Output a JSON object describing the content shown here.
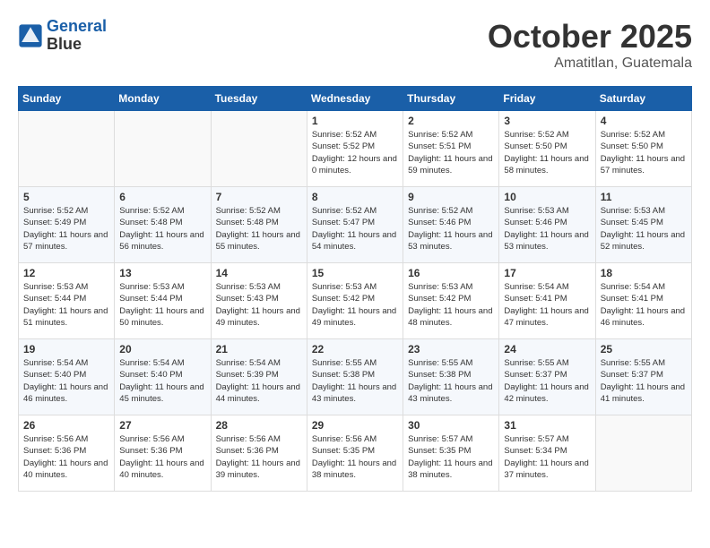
{
  "header": {
    "logo_line1": "General",
    "logo_line2": "Blue",
    "month": "October 2025",
    "location": "Amatitlan, Guatemala"
  },
  "days_of_week": [
    "Sunday",
    "Monday",
    "Tuesday",
    "Wednesday",
    "Thursday",
    "Friday",
    "Saturday"
  ],
  "weeks": [
    [
      {
        "num": "",
        "sunrise": "",
        "sunset": "",
        "daylight": "",
        "empty": true
      },
      {
        "num": "",
        "sunrise": "",
        "sunset": "",
        "daylight": "",
        "empty": true
      },
      {
        "num": "",
        "sunrise": "",
        "sunset": "",
        "daylight": "",
        "empty": true
      },
      {
        "num": "1",
        "sunrise": "Sunrise: 5:52 AM",
        "sunset": "Sunset: 5:52 PM",
        "daylight": "Daylight: 12 hours and 0 minutes.",
        "empty": false
      },
      {
        "num": "2",
        "sunrise": "Sunrise: 5:52 AM",
        "sunset": "Sunset: 5:51 PM",
        "daylight": "Daylight: 11 hours and 59 minutes.",
        "empty": false
      },
      {
        "num": "3",
        "sunrise": "Sunrise: 5:52 AM",
        "sunset": "Sunset: 5:50 PM",
        "daylight": "Daylight: 11 hours and 58 minutes.",
        "empty": false
      },
      {
        "num": "4",
        "sunrise": "Sunrise: 5:52 AM",
        "sunset": "Sunset: 5:50 PM",
        "daylight": "Daylight: 11 hours and 57 minutes.",
        "empty": false
      }
    ],
    [
      {
        "num": "5",
        "sunrise": "Sunrise: 5:52 AM",
        "sunset": "Sunset: 5:49 PM",
        "daylight": "Daylight: 11 hours and 57 minutes.",
        "empty": false
      },
      {
        "num": "6",
        "sunrise": "Sunrise: 5:52 AM",
        "sunset": "Sunset: 5:48 PM",
        "daylight": "Daylight: 11 hours and 56 minutes.",
        "empty": false
      },
      {
        "num": "7",
        "sunrise": "Sunrise: 5:52 AM",
        "sunset": "Sunset: 5:48 PM",
        "daylight": "Daylight: 11 hours and 55 minutes.",
        "empty": false
      },
      {
        "num": "8",
        "sunrise": "Sunrise: 5:52 AM",
        "sunset": "Sunset: 5:47 PM",
        "daylight": "Daylight: 11 hours and 54 minutes.",
        "empty": false
      },
      {
        "num": "9",
        "sunrise": "Sunrise: 5:52 AM",
        "sunset": "Sunset: 5:46 PM",
        "daylight": "Daylight: 11 hours and 53 minutes.",
        "empty": false
      },
      {
        "num": "10",
        "sunrise": "Sunrise: 5:53 AM",
        "sunset": "Sunset: 5:46 PM",
        "daylight": "Daylight: 11 hours and 53 minutes.",
        "empty": false
      },
      {
        "num": "11",
        "sunrise": "Sunrise: 5:53 AM",
        "sunset": "Sunset: 5:45 PM",
        "daylight": "Daylight: 11 hours and 52 minutes.",
        "empty": false
      }
    ],
    [
      {
        "num": "12",
        "sunrise": "Sunrise: 5:53 AM",
        "sunset": "Sunset: 5:44 PM",
        "daylight": "Daylight: 11 hours and 51 minutes.",
        "empty": false
      },
      {
        "num": "13",
        "sunrise": "Sunrise: 5:53 AM",
        "sunset": "Sunset: 5:44 PM",
        "daylight": "Daylight: 11 hours and 50 minutes.",
        "empty": false
      },
      {
        "num": "14",
        "sunrise": "Sunrise: 5:53 AM",
        "sunset": "Sunset: 5:43 PM",
        "daylight": "Daylight: 11 hours and 49 minutes.",
        "empty": false
      },
      {
        "num": "15",
        "sunrise": "Sunrise: 5:53 AM",
        "sunset": "Sunset: 5:42 PM",
        "daylight": "Daylight: 11 hours and 49 minutes.",
        "empty": false
      },
      {
        "num": "16",
        "sunrise": "Sunrise: 5:53 AM",
        "sunset": "Sunset: 5:42 PM",
        "daylight": "Daylight: 11 hours and 48 minutes.",
        "empty": false
      },
      {
        "num": "17",
        "sunrise": "Sunrise: 5:54 AM",
        "sunset": "Sunset: 5:41 PM",
        "daylight": "Daylight: 11 hours and 47 minutes.",
        "empty": false
      },
      {
        "num": "18",
        "sunrise": "Sunrise: 5:54 AM",
        "sunset": "Sunset: 5:41 PM",
        "daylight": "Daylight: 11 hours and 46 minutes.",
        "empty": false
      }
    ],
    [
      {
        "num": "19",
        "sunrise": "Sunrise: 5:54 AM",
        "sunset": "Sunset: 5:40 PM",
        "daylight": "Daylight: 11 hours and 46 minutes.",
        "empty": false
      },
      {
        "num": "20",
        "sunrise": "Sunrise: 5:54 AM",
        "sunset": "Sunset: 5:40 PM",
        "daylight": "Daylight: 11 hours and 45 minutes.",
        "empty": false
      },
      {
        "num": "21",
        "sunrise": "Sunrise: 5:54 AM",
        "sunset": "Sunset: 5:39 PM",
        "daylight": "Daylight: 11 hours and 44 minutes.",
        "empty": false
      },
      {
        "num": "22",
        "sunrise": "Sunrise: 5:55 AM",
        "sunset": "Sunset: 5:38 PM",
        "daylight": "Daylight: 11 hours and 43 minutes.",
        "empty": false
      },
      {
        "num": "23",
        "sunrise": "Sunrise: 5:55 AM",
        "sunset": "Sunset: 5:38 PM",
        "daylight": "Daylight: 11 hours and 43 minutes.",
        "empty": false
      },
      {
        "num": "24",
        "sunrise": "Sunrise: 5:55 AM",
        "sunset": "Sunset: 5:37 PM",
        "daylight": "Daylight: 11 hours and 42 minutes.",
        "empty": false
      },
      {
        "num": "25",
        "sunrise": "Sunrise: 5:55 AM",
        "sunset": "Sunset: 5:37 PM",
        "daylight": "Daylight: 11 hours and 41 minutes.",
        "empty": false
      }
    ],
    [
      {
        "num": "26",
        "sunrise": "Sunrise: 5:56 AM",
        "sunset": "Sunset: 5:36 PM",
        "daylight": "Daylight: 11 hours and 40 minutes.",
        "empty": false
      },
      {
        "num": "27",
        "sunrise": "Sunrise: 5:56 AM",
        "sunset": "Sunset: 5:36 PM",
        "daylight": "Daylight: 11 hours and 40 minutes.",
        "empty": false
      },
      {
        "num": "28",
        "sunrise": "Sunrise: 5:56 AM",
        "sunset": "Sunset: 5:36 PM",
        "daylight": "Daylight: 11 hours and 39 minutes.",
        "empty": false
      },
      {
        "num": "29",
        "sunrise": "Sunrise: 5:56 AM",
        "sunset": "Sunset: 5:35 PM",
        "daylight": "Daylight: 11 hours and 38 minutes.",
        "empty": false
      },
      {
        "num": "30",
        "sunrise": "Sunrise: 5:57 AM",
        "sunset": "Sunset: 5:35 PM",
        "daylight": "Daylight: 11 hours and 38 minutes.",
        "empty": false
      },
      {
        "num": "31",
        "sunrise": "Sunrise: 5:57 AM",
        "sunset": "Sunset: 5:34 PM",
        "daylight": "Daylight: 11 hours and 37 minutes.",
        "empty": false
      },
      {
        "num": "",
        "sunrise": "",
        "sunset": "",
        "daylight": "",
        "empty": true
      }
    ]
  ]
}
